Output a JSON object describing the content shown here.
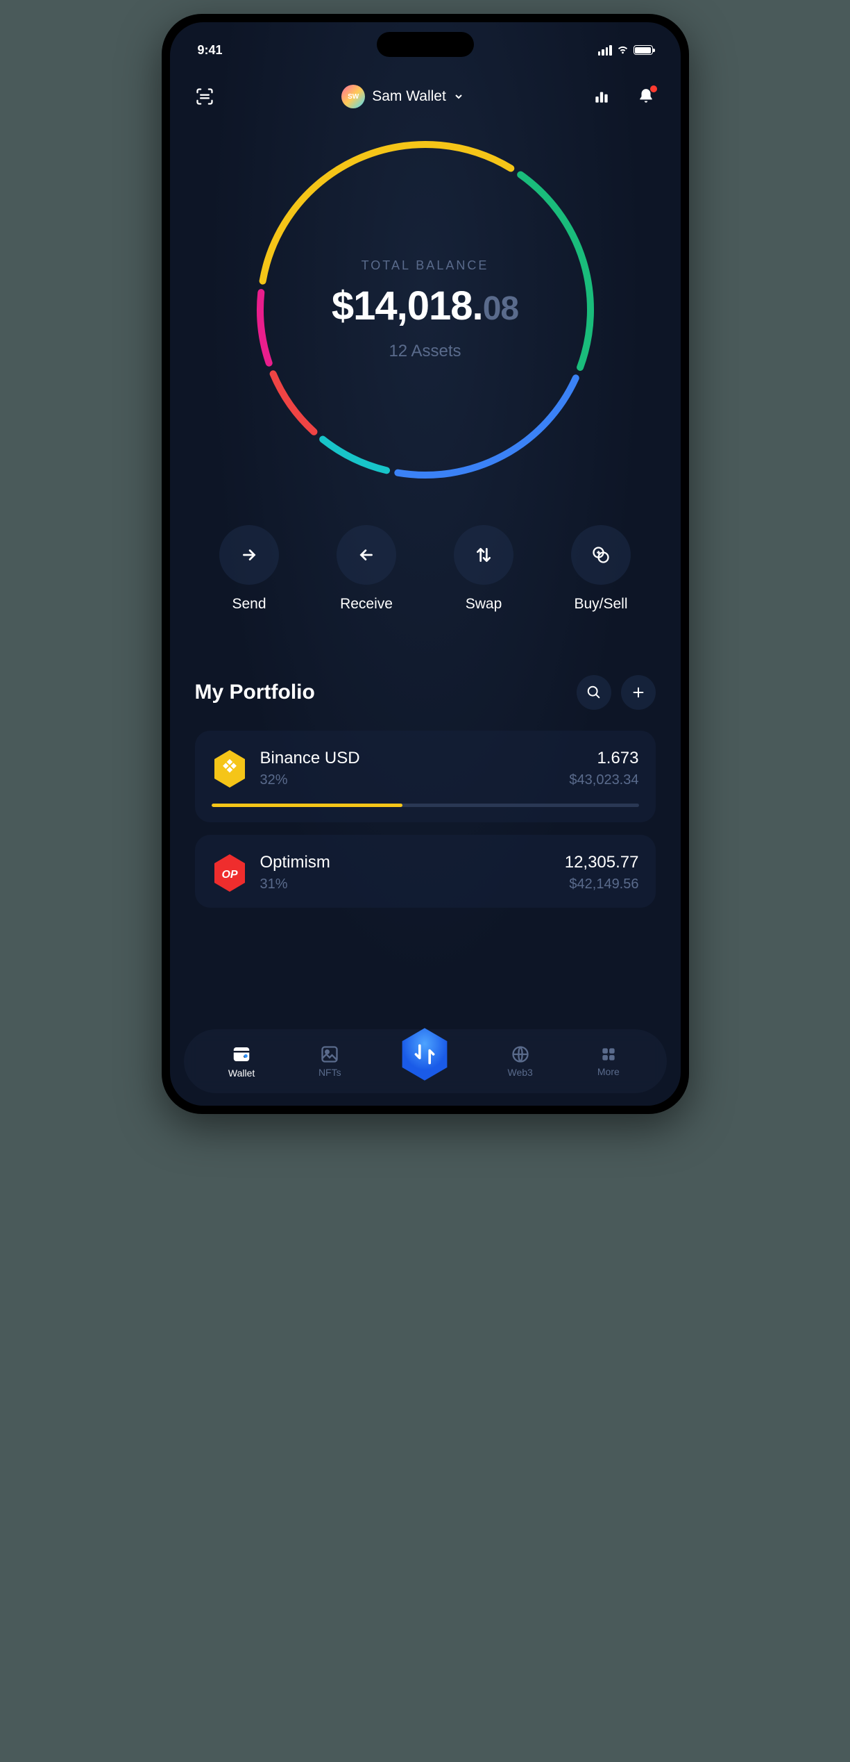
{
  "status": {
    "time": "9:41"
  },
  "header": {
    "avatar_initials": "SW",
    "wallet_name": "Sam Wallet"
  },
  "balance": {
    "label": "TOTAL BALANCE",
    "amount_main": "$14,018.",
    "amount_cents": "08",
    "asset_count": "12 Assets"
  },
  "chart_data": {
    "type": "pie",
    "title": "Total Balance Allocation",
    "series": [
      {
        "name": "yellow",
        "color": "#f5c518",
        "percent": 32
      },
      {
        "name": "green",
        "color": "#1abc7b",
        "percent": 22
      },
      {
        "name": "blue",
        "color": "#3b82f6",
        "percent": 22
      },
      {
        "name": "teal",
        "color": "#18c5c9",
        "percent": 8
      },
      {
        "name": "red",
        "color": "#ef4444",
        "percent": 8
      },
      {
        "name": "magenta",
        "color": "#e91e8c",
        "percent": 8
      }
    ]
  },
  "actions": {
    "send": {
      "label": "Send"
    },
    "receive": {
      "label": "Receive"
    },
    "swap": {
      "label": "Swap"
    },
    "buysell": {
      "label": "Buy/Sell"
    }
  },
  "portfolio": {
    "title": "My Portfolio",
    "assets": [
      {
        "name": "Binance USD",
        "pct": "32%",
        "pct_num": 32,
        "amount": "1.673",
        "value": "$43,023.34",
        "color": "#f5c518",
        "badge": "busd"
      },
      {
        "name": "Optimism",
        "pct": "31%",
        "pct_num": 31,
        "amount": "12,305.77",
        "value": "$42,149.56",
        "color": "#ef2d2d",
        "badge": "OP"
      }
    ]
  },
  "nav": {
    "wallet": "Wallet",
    "nfts": "NFTs",
    "web3": "Web3",
    "more": "More"
  }
}
